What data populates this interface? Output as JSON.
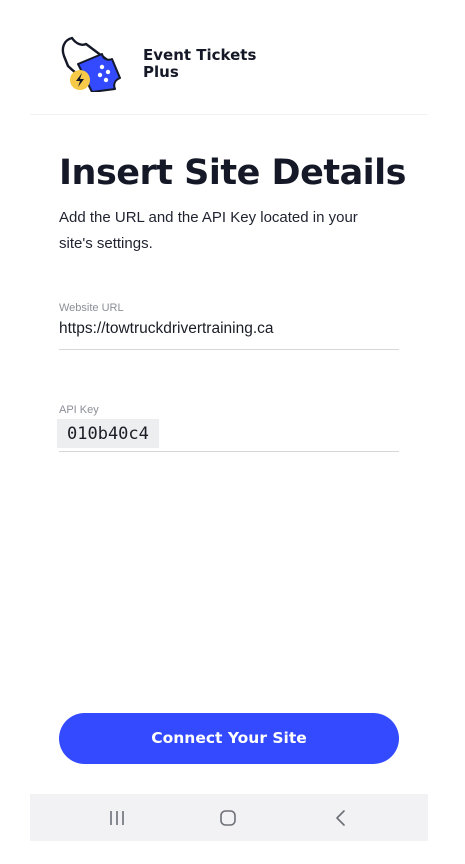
{
  "header": {
    "brand_line1": "Event Tickets",
    "brand_line2": "Plus",
    "logo_icon": "ticket-lightning-logo"
  },
  "page": {
    "title": "Insert Site Details",
    "subtitle": "Add the URL and the API Key located in your site's settings."
  },
  "form": {
    "url_label": "Website URL",
    "url_value": "https://towtruckdrivertraining.ca",
    "api_key_label": "API Key",
    "api_key_value": "010b40c4"
  },
  "actions": {
    "connect_label": "Connect Your Site"
  },
  "navbar": {
    "recent_icon": "recent-apps-icon",
    "home_icon": "home-icon",
    "back_icon": "back-icon"
  },
  "colors": {
    "accent": "#334aff",
    "text": "#141827",
    "logo_yellow": "#f7c948",
    "navbar_bg": "#f2f2f4"
  }
}
